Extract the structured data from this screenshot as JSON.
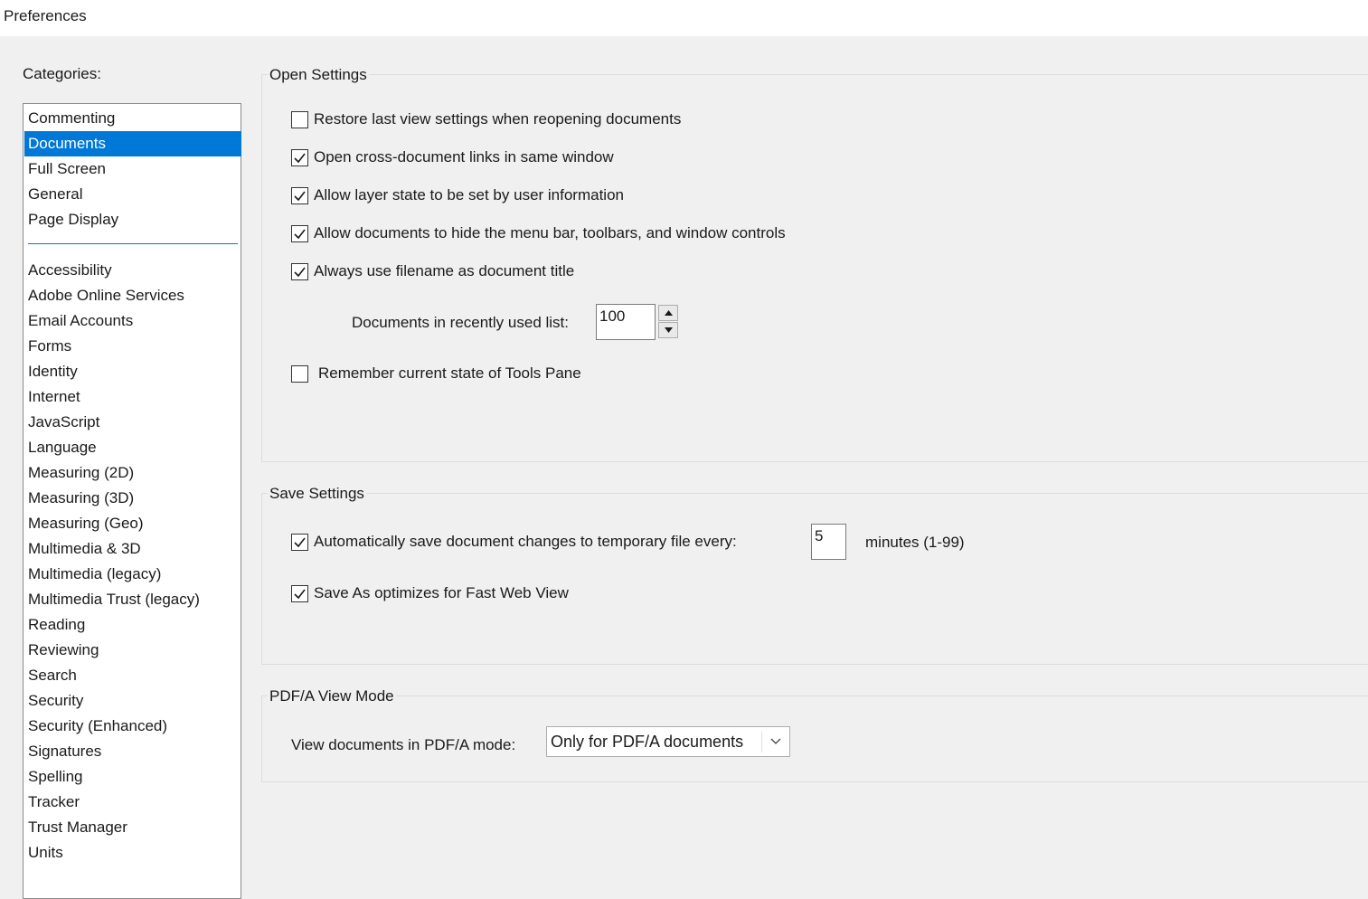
{
  "window": {
    "title": "Preferences"
  },
  "categories": {
    "label": "Categories:",
    "top_items": [
      "Commenting",
      "Documents",
      "Full Screen",
      "General",
      "Page Display"
    ],
    "selected": "Documents",
    "items": [
      "Accessibility",
      "Adobe Online Services",
      "Email Accounts",
      "Forms",
      "Identity",
      "Internet",
      "JavaScript",
      "Language",
      "Measuring (2D)",
      "Measuring (3D)",
      "Measuring (Geo)",
      "Multimedia & 3D",
      "Multimedia (legacy)",
      "Multimedia Trust (legacy)",
      "Reading",
      "Reviewing",
      "Search",
      "Security",
      "Security (Enhanced)",
      "Signatures",
      "Spelling",
      "Tracker",
      "Trust Manager",
      "Units"
    ]
  },
  "open_settings": {
    "title": "Open Settings",
    "checkboxes": [
      {
        "label": "Restore last view settings when reopening documents",
        "checked": false
      },
      {
        "label": "Open cross-document links in same window",
        "checked": true
      },
      {
        "label": "Allow layer state to be set by user information",
        "checked": true
      },
      {
        "label": "Allow documents to hide the menu bar, toolbars, and window controls",
        "checked": true
      },
      {
        "label": "Always use filename as document title",
        "checked": true
      }
    ],
    "recent_label": "Documents in recently used list:",
    "recent_value": "100",
    "tools_pane": {
      "label": "Remember current state of Tools Pane",
      "checked": false
    }
  },
  "save_settings": {
    "title": "Save Settings",
    "autosave": {
      "label": "Automatically save document changes to temporary file every:",
      "checked": true,
      "value": "5",
      "unit": "minutes (1-99)"
    },
    "fast_web": {
      "label": "Save As optimizes for Fast Web View",
      "checked": true
    }
  },
  "pdfa": {
    "title": "PDF/A View Mode",
    "label": "View documents in PDF/A mode:",
    "selected": "Only for PDF/A documents"
  }
}
